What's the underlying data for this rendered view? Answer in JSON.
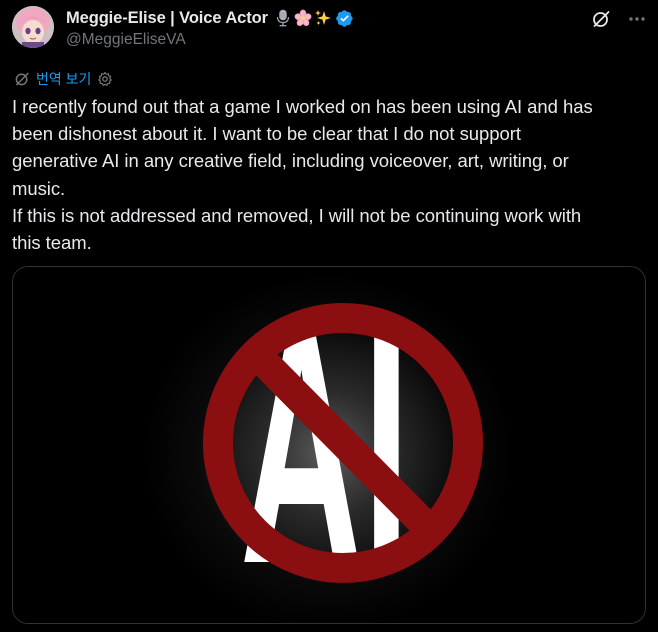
{
  "author": {
    "display_name": "Meggie-Elise | Voice Actor",
    "handle": "@MeggieEliseVA",
    "name_emojis": [
      "microphone-icon",
      "cherry-blossom-icon",
      "sparkles-icon"
    ],
    "verified": true
  },
  "header_actions": [
    "grok-icon",
    "more-icon"
  ],
  "translate": {
    "label": "번역 보기"
  },
  "tweet": {
    "lines": [
      "I recently found out that a game I worked on has been using AI and has",
      "been dishonest about it. I want to be clear that I do not support",
      "generative AI in any creative field, including voiceover, art, writing, or",
      "music.",
      "If this is not addressed and removed, I will not be continuing work with",
      "this team."
    ]
  },
  "media": {
    "image_text": "AI",
    "symbol": "prohibition-sign",
    "colors": {
      "ring": "#8b0e10",
      "letters": "#ffffff",
      "background": "#000000"
    }
  },
  "colors": {
    "link": "#1d9bf0",
    "verified": "#1d9bf0",
    "secondary_text": "#71767b",
    "border": "#2f3336"
  }
}
